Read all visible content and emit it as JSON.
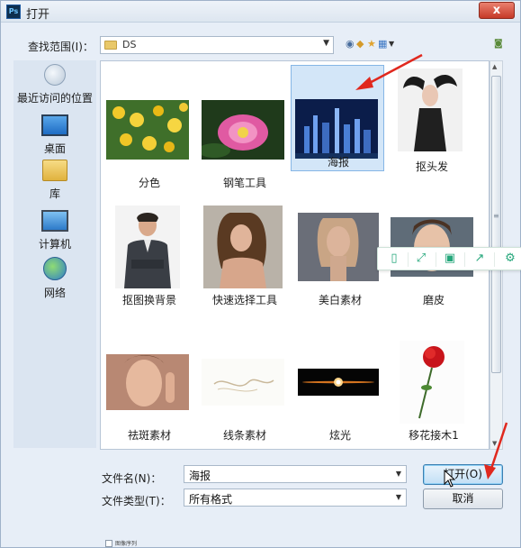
{
  "window": {
    "title": "打开",
    "app_icon": "photoshop-icon",
    "close_label": "x"
  },
  "lookin": {
    "label": "查找范围(I)：",
    "path": "DS"
  },
  "places": [
    {
      "key": "recent",
      "label": "最近访问的位置"
    },
    {
      "key": "desktop",
      "label": "桌面"
    },
    {
      "key": "library",
      "label": "库"
    },
    {
      "key": "computer",
      "label": "计算机"
    },
    {
      "key": "network",
      "label": "网络"
    }
  ],
  "files": [
    {
      "name": "分色",
      "subject": "yellow-roses-photo",
      "selected": false
    },
    {
      "name": "钢笔工具",
      "subject": "lotus-flower-photo",
      "selected": false
    },
    {
      "name": "海报",
      "subject": "city-night-skyline-photo",
      "selected": true
    },
    {
      "name": "抠头发",
      "subject": "woman-flowing-hair-photo",
      "selected": false
    },
    {
      "name": "抠图换背景",
      "subject": "businessman-portrait-photo",
      "selected": false
    },
    {
      "name": "快速选择工具",
      "subject": "woman-portrait-photo",
      "selected": false
    },
    {
      "name": "美白素材",
      "subject": "woman-face-photo",
      "selected": false
    },
    {
      "name": "磨皮",
      "subject": "woman-closeup-photo",
      "selected": false
    },
    {
      "name": "祛斑素材",
      "subject": "woman-face-hand-photo",
      "selected": false
    },
    {
      "name": "线条素材",
      "subject": "line-sketch-drawing",
      "selected": false
    },
    {
      "name": "炫光",
      "subject": "light-flare-photo",
      "selected": false
    },
    {
      "name": "移花接木1",
      "subject": "red-rose-photo",
      "selected": false
    }
  ],
  "filename": {
    "label": "文件名(N)：",
    "value": "海报"
  },
  "filetype": {
    "label": "文件类型(T)：",
    "value": "所有格式"
  },
  "buttons": {
    "open": "打开(O)",
    "cancel": "取消"
  },
  "image_sequence": {
    "label": "图像序列"
  },
  "colors": {
    "selection": "#d3e6f8",
    "float_toolbar": "#25a77b",
    "annotation_arrow": "#e0281e"
  }
}
